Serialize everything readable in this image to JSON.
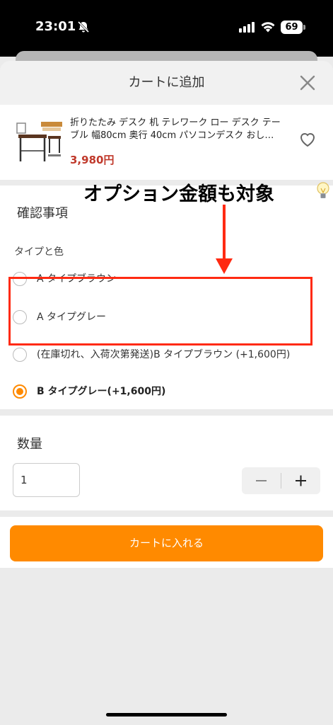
{
  "status_bar": {
    "time": "23:01",
    "battery": "69"
  },
  "sheet": {
    "title": "カートに追加"
  },
  "product": {
    "name_line1": "折りたたみ デスク 机 テレワーク ロー デスク テー",
    "name_line2": "ブル 幅80cm 奥行 40cm パソコンデスク おし…",
    "price": "3,980円"
  },
  "confirm": {
    "title": "確認事項",
    "option_label": "タイプと色",
    "options": [
      {
        "label": "A タイプブラウン",
        "selected": false
      },
      {
        "label": "A タイプグレー",
        "selected": false
      },
      {
        "label": "(在庫切れ、入荷次第発送)B タイプブラウン (+1,600円)",
        "selected": false
      },
      {
        "label": "B タイプグレー(+1,600円)",
        "selected": true
      }
    ]
  },
  "annotation": {
    "text": "オプション金額も対象",
    "color": "#ff2a12"
  },
  "quantity": {
    "title": "数量",
    "value": "1"
  },
  "cart_button": {
    "label": "カートに入れる",
    "color": "#ff8a00"
  }
}
